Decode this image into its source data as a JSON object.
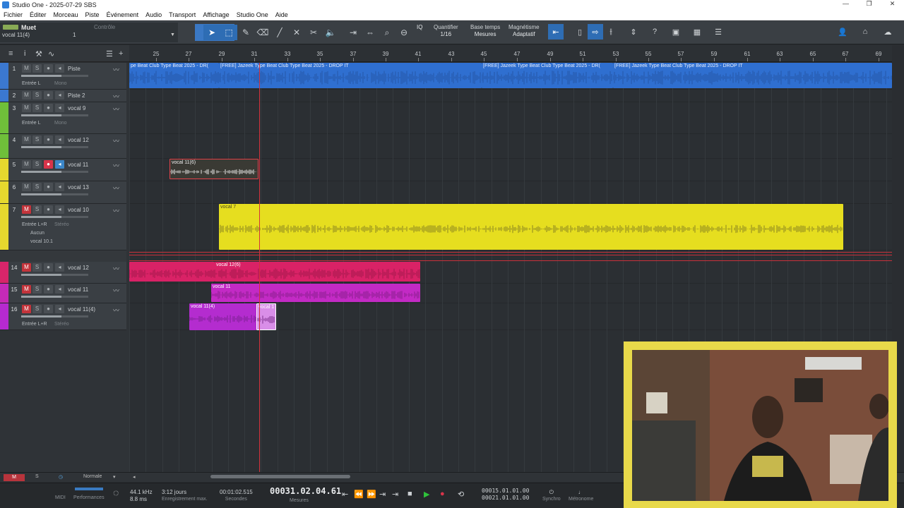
{
  "window": {
    "title": "Studio One - 2025-07-29 SBS",
    "controls": [
      "—",
      "❐",
      "✕"
    ]
  },
  "menu": [
    "Fichier",
    "Éditer",
    "Morceau",
    "Piste",
    "Événement",
    "Audio",
    "Transport",
    "Affichage",
    "Studio One",
    "Aide"
  ],
  "toolbar": {
    "left": {
      "title": "Muet",
      "subtitle": "vocal 11(4)",
      "value": "1",
      "controle": "Contrôle"
    },
    "quantize": {
      "label": "Quantifier",
      "value": "1/16"
    },
    "timebase": {
      "label": "Base temps",
      "value": "Mesures"
    },
    "snap": {
      "label": "Magnétisme",
      "value": "Adaptatif"
    },
    "iq": "IQ"
  },
  "ruler": {
    "ticks": [
      "25",
      "27",
      "29",
      "31",
      "33",
      "35",
      "37",
      "39",
      "41",
      "43",
      "45",
      "47",
      "49",
      "51",
      "53",
      "55",
      "57",
      "59",
      "61",
      "63",
      "65",
      "67",
      "69"
    ]
  },
  "tracks": [
    {
      "num": "1",
      "name": "Piste",
      "color": "#3b78d0",
      "sub": "Entrée L",
      "sub2": "Mono"
    },
    {
      "num": "2",
      "name": "Piste 2",
      "color": "#3b78d0"
    },
    {
      "num": "3",
      "name": "vocal 9",
      "color": "#6fbf3a",
      "sub": "Entrée L",
      "sub2": "Mono"
    },
    {
      "num": "4",
      "name": "vocal 12",
      "color": "#6fbf3a"
    },
    {
      "num": "5",
      "name": "vocal 11",
      "color": "#e6d82e"
    },
    {
      "num": "6",
      "name": "vocal 13",
      "color": "#e6d82e"
    },
    {
      "num": "7",
      "name": "vocal 10",
      "color": "#e6d82e",
      "sub": "Entrée L+R",
      "sub2": "Stéréo",
      "sub3": "Aucun",
      "sub4": "vocal 10.1"
    },
    {
      "num": "14",
      "name": "vocal 12",
      "color": "#d8256a"
    },
    {
      "num": "15",
      "name": "vocal 11",
      "color": "#c52ab8"
    },
    {
      "num": "16",
      "name": "vocal 11(4)",
      "color": "#b62ad0",
      "sub": "Entrée L+R",
      "sub2": "Stéréo"
    }
  ],
  "clips": {
    "beat1": "pe Beat  Club Type Beat 2025 - DR(",
    "beat2": "[FREE] Jazeek Type Beat  Club Type Beat 2025 - DROP IT",
    "beat3": "[FREE] Jazeek Type Beat  Club Type Beat 2025 - DR(",
    "beat4": "[FREE] Jazeek Type Beat  Club Type Beat 2025 - DROP IT",
    "v11_6": "vocal 11(6)",
    "v7": "vocal 7",
    "v12_6": "vocal 12(6)",
    "v11": "vocal 11",
    "v11_4": "vocal 11(4)",
    "v11_sel": "vocal 1"
  },
  "buttons": {
    "m": "M",
    "s": "S"
  },
  "bottombar": {
    "m": "M",
    "s": "S",
    "mode": "Normale"
  },
  "transport": {
    "rate": "44.1 kHz",
    "latency": "8.8 ms",
    "midi": "MIDI",
    "perf": "Performances",
    "days": "3:12 jours",
    "days_lbl": "Enregistrement max.",
    "seconds": "00:01:02.515",
    "seconds_lbl": "Secondes",
    "bars": "00031.02.04.61",
    "bars_lbl": "Mesures",
    "loop_l": "00015.01.01.00",
    "loop_r": "00021.01.01.00",
    "sync": "Synchro",
    "metro": "Métronome"
  },
  "colors": {
    "accent": "#2e6db4",
    "record": "#d8344a",
    "play": "#2fc23b"
  }
}
